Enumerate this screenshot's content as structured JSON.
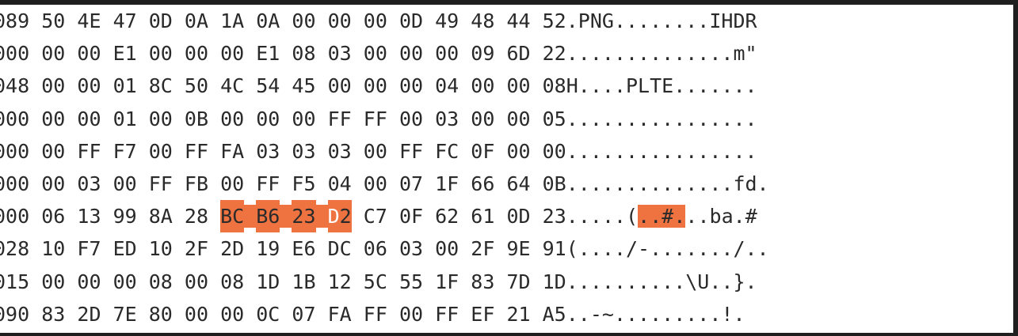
{
  "colors": {
    "background": "#ffffff",
    "text": "#2a2a2a",
    "selection": "#ee7340",
    "frame": "#1f1f1f"
  },
  "hex_view": {
    "rows": [
      {
        "offset_tail": "089",
        "hex": [
          "50",
          "4E",
          "47",
          "0D",
          "0A",
          "1A",
          "0A",
          "00",
          "00",
          "00",
          "0D",
          "49",
          "48",
          "44",
          "52"
        ],
        "ascii": ".PNG........IHDR"
      },
      {
        "offset_tail": "000",
        "hex": [
          "00",
          "00",
          "E1",
          "00",
          "00",
          "00",
          "E1",
          "08",
          "03",
          "00",
          "00",
          "00",
          "09",
          "6D",
          "22"
        ],
        "ascii": "..............m\""
      },
      {
        "offset_tail": "048",
        "hex": [
          "00",
          "00",
          "01",
          "8C",
          "50",
          "4C",
          "54",
          "45",
          "00",
          "00",
          "00",
          "04",
          "00",
          "00",
          "08"
        ],
        "ascii": "H....PLTE......."
      },
      {
        "offset_tail": "000",
        "hex": [
          "00",
          "00",
          "01",
          "00",
          "0B",
          "00",
          "00",
          "00",
          "FF",
          "FF",
          "00",
          "03",
          "00",
          "00",
          "05"
        ],
        "ascii": "................"
      },
      {
        "offset_tail": "000",
        "hex": [
          "00",
          "FF",
          "F7",
          "00",
          "FF",
          "FA",
          "03",
          "03",
          "03",
          "00",
          "FF",
          "FC",
          "0F",
          "00",
          "00"
        ],
        "ascii": "................"
      },
      {
        "offset_tail": "000",
        "hex": [
          "00",
          "03",
          "00",
          "FF",
          "FB",
          "00",
          "FF",
          "F5",
          "04",
          "00",
          "07",
          "1F",
          "66",
          "64",
          "0B"
        ],
        "ascii": "..............fd."
      },
      {
        "offset_tail": "000",
        "hex": [
          "06",
          "13",
          "99",
          "8A",
          "28",
          "BC",
          "B6",
          "23",
          "D2",
          "C7",
          "0F",
          "62",
          "61",
          "0D",
          "23"
        ],
        "ascii": ".....(..#...ba.#",
        "selected_hex": [
          5,
          6,
          7,
          8
        ],
        "selected_ascii": [
          6,
          7,
          8,
          9
        ]
      },
      {
        "offset_tail": "028",
        "hex": [
          "10",
          "F7",
          "ED",
          "10",
          "2F",
          "2D",
          "19",
          "E6",
          "DC",
          "06",
          "03",
          "00",
          "2F",
          "9E",
          "91"
        ],
        "ascii": "(..../-......./.."
      },
      {
        "offset_tail": "015",
        "hex": [
          "00",
          "00",
          "00",
          "08",
          "00",
          "08",
          "1D",
          "1B",
          "12",
          "5C",
          "55",
          "1F",
          "83",
          "7D",
          "1D"
        ],
        "ascii": "..........\\U..}."
      },
      {
        "offset_tail": "090",
        "hex": [
          "83",
          "2D",
          "7E",
          "80",
          "00",
          "00",
          "0C",
          "07",
          "FA",
          "FF",
          "00",
          "FF",
          "EF",
          "21",
          "A5"
        ],
        "ascii": "..-~.........!."
      }
    ]
  }
}
